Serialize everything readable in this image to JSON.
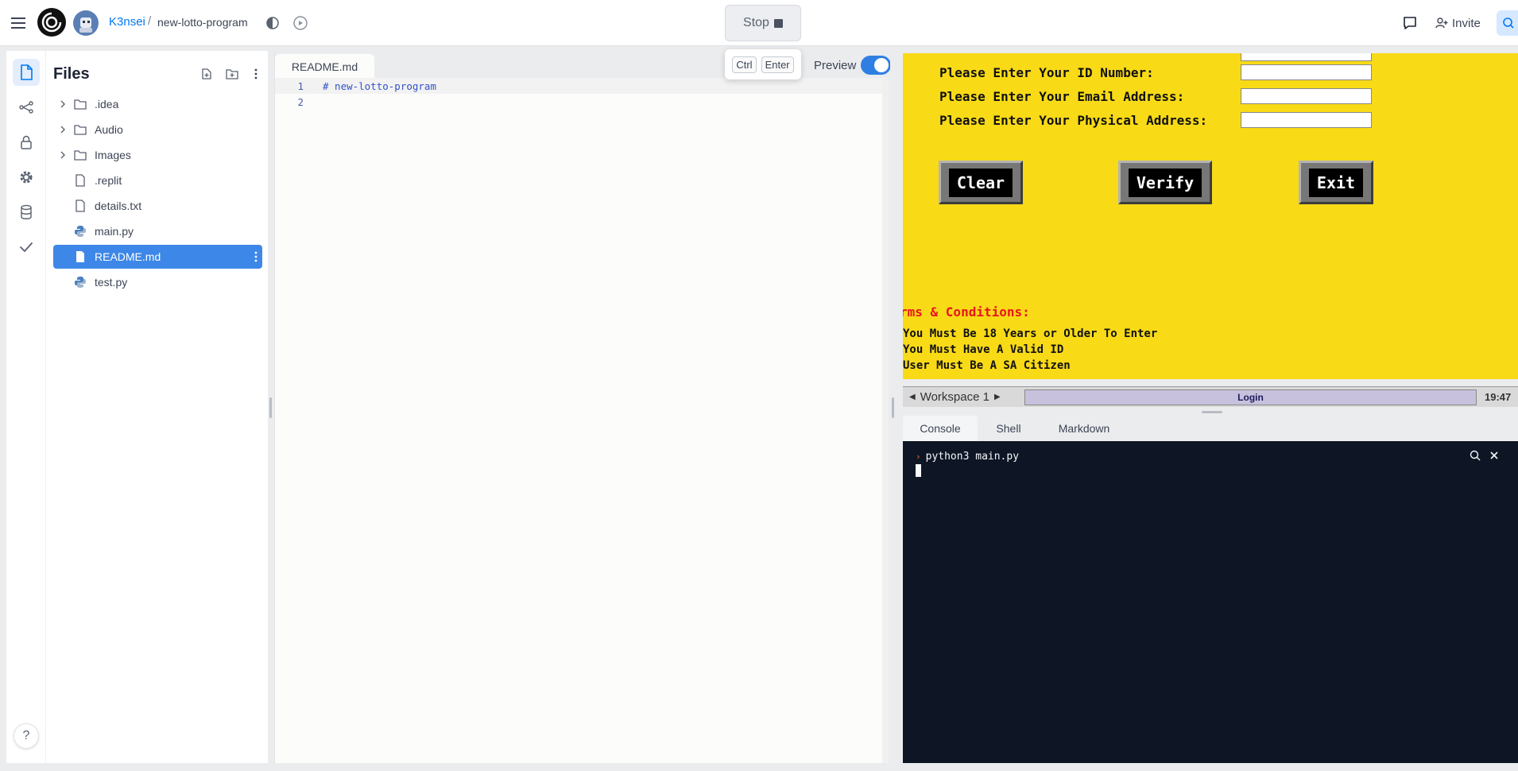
{
  "topbar": {
    "user": "K3nsei",
    "separator": "/",
    "repl_name": "new-lotto-program",
    "stop_label": "Stop",
    "invite_label": "Invite"
  },
  "shortcut": {
    "key1": "Ctrl",
    "key2": "Enter"
  },
  "files": {
    "title": "Files",
    "items": [
      {
        "label": ".idea",
        "type": "folder"
      },
      {
        "label": "Audio",
        "type": "folder"
      },
      {
        "label": "Images",
        "type": "folder"
      },
      {
        "label": ".replit",
        "type": "file"
      },
      {
        "label": "details.txt",
        "type": "file"
      },
      {
        "label": "main.py",
        "type": "python"
      },
      {
        "label": "README.md",
        "type": "file",
        "selected": true
      },
      {
        "label": "test.py",
        "type": "python"
      }
    ]
  },
  "editor": {
    "tab": "README.md",
    "preview_label": "Preview",
    "preview_on": true,
    "lines": [
      {
        "num": "1",
        "text": "# new-lotto-program"
      },
      {
        "num": "2",
        "text": ""
      }
    ]
  },
  "app_window": {
    "fields": [
      "Please Enter Your ID Number:",
      "Please Enter Your Email Address:",
      "Please Enter Your Physical Address:"
    ],
    "buttons": [
      "Clear",
      "Verify",
      "Exit"
    ],
    "terms_heading": "rms & Conditions:",
    "terms": [
      "You Must Be 18 Years or Older To Enter",
      "You Must Have A Valid ID",
      "User Must Be A SA Citizen"
    ]
  },
  "taskbar": {
    "workspace": "Workspace 1",
    "task": "Login",
    "clock": "19:47"
  },
  "console": {
    "tabs": [
      "Console",
      "Shell",
      "Markdown"
    ],
    "command": "python3 main.py"
  },
  "help_label": "?",
  "colors": {
    "accent": "#0079f2",
    "app_bg": "#f8da17",
    "console_bg": "#0e1525",
    "terms_red": "#e8161b"
  }
}
